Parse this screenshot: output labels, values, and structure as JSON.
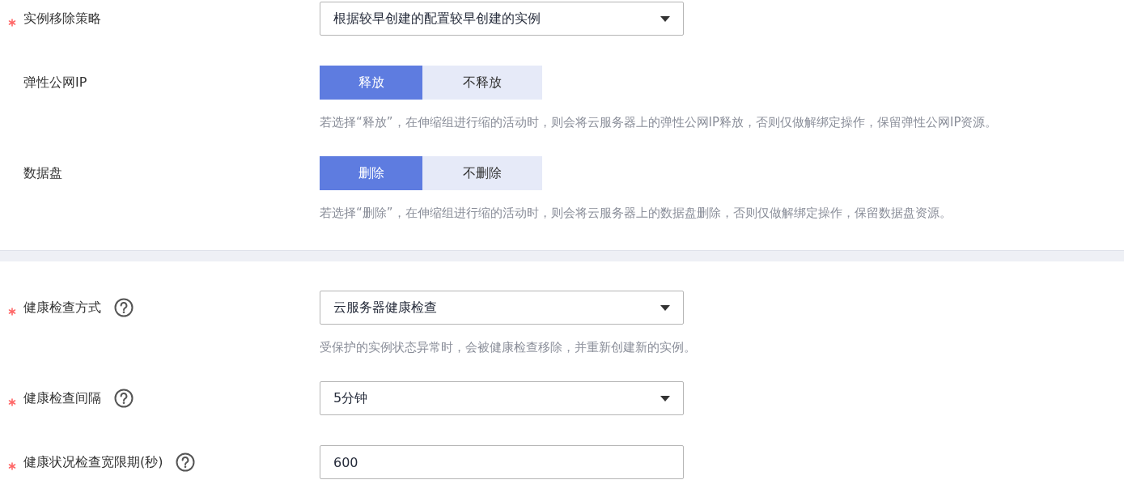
{
  "sections": [
    {
      "fields": [
        {
          "kind": "select",
          "label": "实例移除策略",
          "required": true,
          "help": false,
          "value": "根据较早创建的配置较早创建的实例"
        },
        {
          "kind": "toggle",
          "label": "弹性公网IP",
          "required": false,
          "help": false,
          "options": [
            {
              "label": "释放",
              "selected": true
            },
            {
              "label": "不释放",
              "selected": false
            }
          ],
          "hint": "若选择“释放”，在伸缩组进行缩的活动时，则会将云服务器上的弹性公网IP释放，否则仅做解绑定操作，保留弹性公网IP资源。"
        },
        {
          "kind": "toggle",
          "label": "数据盘",
          "required": false,
          "help": false,
          "options": [
            {
              "label": "删除",
              "selected": true
            },
            {
              "label": "不删除",
              "selected": false
            }
          ],
          "hint": "若选择“删除”，在伸缩组进行缩的活动时，则会将云服务器上的数据盘删除，否则仅做解绑定操作，保留数据盘资源。"
        }
      ]
    },
    {
      "fields": [
        {
          "kind": "select",
          "label": "健康检查方式",
          "required": true,
          "help": true,
          "value": "云服务器健康检查",
          "hint": "受保护的实例状态异常时，会被健康检查移除，并重新创建新的实例。"
        },
        {
          "kind": "select",
          "label": "健康检查间隔",
          "required": true,
          "help": true,
          "value": "5分钟"
        },
        {
          "kind": "input",
          "label": "健康状况检查宽限期(秒)",
          "required": true,
          "help": true,
          "value": "600"
        }
      ]
    }
  ]
}
